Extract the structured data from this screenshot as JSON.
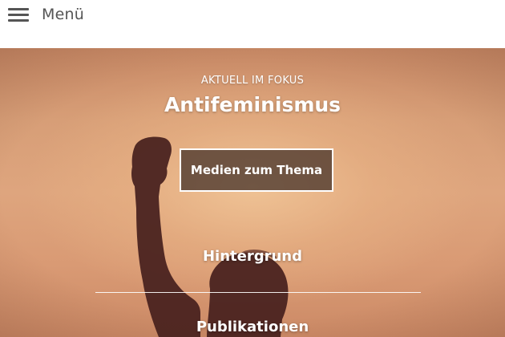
{
  "header": {
    "menu_label": "Menü",
    "menu_icon": "hamburger-menu-icon"
  },
  "hero": {
    "kicker": "AKTUELL IM FOKUS",
    "title": "Antifeminismus",
    "button_label": "Medien zum Thema",
    "links": [
      {
        "label": "Hintergrund"
      },
      {
        "label": "Publikationen"
      }
    ],
    "colors": {
      "overlay_button": "#4b372d",
      "text": "#ffffff"
    }
  }
}
